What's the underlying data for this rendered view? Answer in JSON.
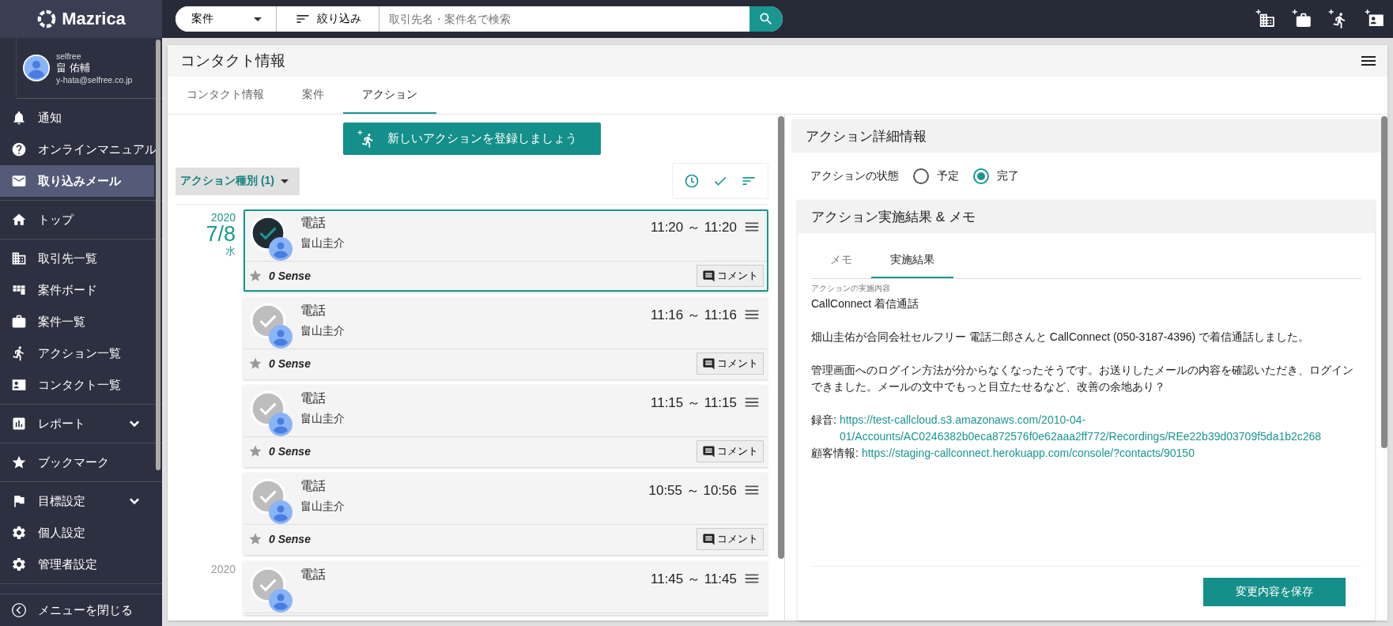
{
  "sidebar": {
    "logo": "Mazrica",
    "user": {
      "org": "selfree",
      "name": "畠 佑輔",
      "email": "y-hata@selfree.co.jp"
    },
    "groups": [
      [
        {
          "label": "通知",
          "selected": false
        },
        {
          "label": "オンラインマニュアル",
          "selected": false
        },
        {
          "label": "取り込みメール",
          "selected": true
        }
      ],
      [
        {
          "label": "トップ",
          "selected": false
        }
      ],
      [
        {
          "label": "取引先一覧",
          "selected": false
        },
        {
          "label": "案件ボード",
          "selected": false
        },
        {
          "label": "案件一覧",
          "selected": false
        },
        {
          "label": "アクション一覧",
          "selected": false
        },
        {
          "label": "コンタクト一覧",
          "selected": false
        }
      ],
      [
        {
          "label": "レポート",
          "selected": false,
          "expanded": false
        }
      ],
      [
        {
          "label": "ブックマーク",
          "selected": false
        }
      ],
      [
        {
          "label": "目標設定",
          "selected": false,
          "expanded": false
        },
        {
          "label": "個人設定",
          "selected": false
        },
        {
          "label": "管理者設定",
          "selected": false
        }
      ]
    ],
    "close": "メニューを閉じる"
  },
  "topbar": {
    "scope": "案件",
    "filter": "絞り込み",
    "search_placeholder": "取引先名・案件名で検索"
  },
  "page": {
    "title": "コンタクト情報",
    "tabs": [
      {
        "label": "コンタクト情報",
        "selected": false
      },
      {
        "label": "案件",
        "selected": false
      },
      {
        "label": "アクション",
        "selected": true
      }
    ]
  },
  "actions": {
    "new_button": "新しいアクションを登録しましょう",
    "type_filter": "アクション種別 (1)",
    "groups": [
      {
        "year": "2020",
        "date": "7/8",
        "weekday": "水",
        "selected": true,
        "cards": [
          {
            "title": "電話",
            "person": "畠山圭介",
            "time": "11:20 ～ 11:20",
            "sense": "0 Sense",
            "comment": "コメント",
            "selected": true
          },
          {
            "title": "電話",
            "person": "畠山圭介",
            "time": "11:16 ～ 11:16",
            "sense": "0 Sense",
            "comment": "コメント",
            "selected": false
          },
          {
            "title": "電話",
            "person": "畠山圭介",
            "time": "11:15 ～ 11:15",
            "sense": "0 Sense",
            "comment": "コメント",
            "selected": false
          },
          {
            "title": "電話",
            "person": "畠山圭介",
            "time": "10:55 ～ 10:56",
            "sense": "0 Sense",
            "comment": "コメント",
            "selected": false
          }
        ]
      },
      {
        "year": "2020",
        "selected": false,
        "cards": [
          {
            "title": "電話",
            "time": "11:45 ～ 11:45",
            "selected": false
          }
        ]
      }
    ]
  },
  "detail": {
    "title": "アクション詳細情報",
    "status_label": "アクションの状態",
    "status_options": [
      {
        "label": "予定",
        "selected": false
      },
      {
        "label": "完了",
        "selected": true
      }
    ],
    "result": {
      "title": "アクション実施結果 & メモ",
      "tabs": [
        {
          "label": "メモ",
          "selected": false
        },
        {
          "label": "実施結果",
          "selected": true
        }
      ],
      "field_label": "アクションの実施内容",
      "summary": "CallConnect 着信通話",
      "paragraphs": [
        "畑山圭佑が合同会社セルフリー 電話二郎さんと CallConnect (050-3187-4396) で着信通話しました。",
        "管理画面へのログイン方法が分からなくなったそうです。お送りしたメールの内容を確認いただき、ログインできました。メールの文中でもっと目立たせるなど、改善の余地あり？"
      ],
      "links": [
        {
          "label": "録音:",
          "url": "https://test-callcloud.s3.amazonaws.com/2010-04-01/Accounts/AC0246382b0eca872576f0e62aaa2ff772/Recordings/REe22b39d03709f5da1b2c268"
        },
        {
          "label": "顧客情報:",
          "url": "https://staging-callconnect.herokuapp.com/console/?contacts/90150"
        }
      ],
      "save": "変更内容を保存"
    }
  }
}
